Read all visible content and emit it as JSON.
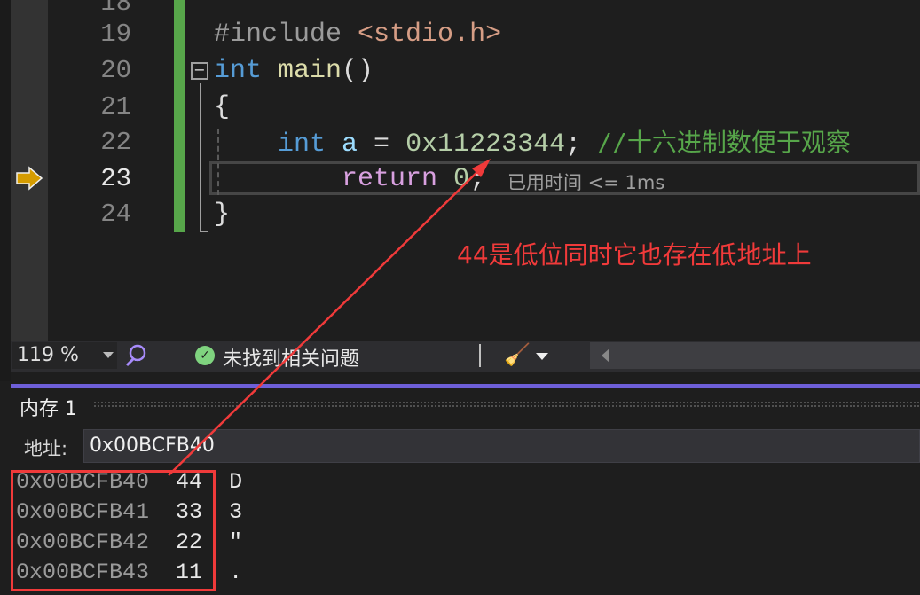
{
  "editor": {
    "line_numbers": [
      "18",
      "19",
      "20",
      "21",
      "22",
      "23",
      "24"
    ],
    "current_line": "23",
    "lines": {
      "l19": {
        "directive": "#include",
        "header": "<stdio.h>"
      },
      "l20": {
        "type": "int",
        "name": "main",
        "parens": "()"
      },
      "l21": "{",
      "l22": {
        "type": "int",
        "var": "a",
        "op": " = ",
        "value": "0x11223344",
        "semi": ";",
        "comment": "//十六进制数便于观察"
      },
      "l23": {
        "keyword": "return",
        "value": "0",
        "semi": ";"
      },
      "l24": "}"
    },
    "perf_hint": "已用时间 <= 1ms",
    "annotation": "44是低位同时它也存在低地址上",
    "annotation_color": "#f03a3a"
  },
  "toolbar": {
    "zoom_level": "119 %",
    "issues_status": "未找到相关问题"
  },
  "memory": {
    "title": "内存 1",
    "address_label": "地址:",
    "address_value": "0x00BCFB40",
    "rows": [
      {
        "address": "0x00BCFB40",
        "value": "44",
        "char": "D"
      },
      {
        "address": "0x00BCFB41",
        "value": "33",
        "char": "3"
      },
      {
        "address": "0x00BCFB42",
        "value": "22",
        "char": "\""
      },
      {
        "address": "0x00BCFB43",
        "value": "11",
        "char": "."
      }
    ]
  },
  "colors": {
    "accent": "#6e5fd8",
    "change_bar": "#57a64a",
    "highlight": "#f03a3a"
  }
}
